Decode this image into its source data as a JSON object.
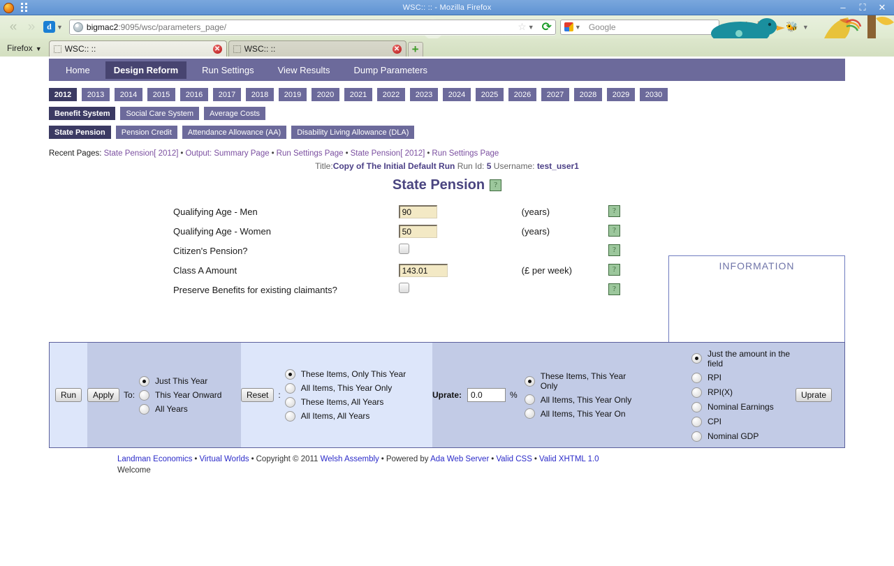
{
  "window": {
    "title": "WSC::  :: - Mozilla Firefox",
    "minimize": "–",
    "maximize": "⛶",
    "close": "✕"
  },
  "browser": {
    "back_icon": "«",
    "forward_icon": "»",
    "d_button": "d",
    "url_host": "bigmac2",
    "url_rest": ":9095/wsc/parameters_page/",
    "url_full": "bigmac2:9095/wsc/parameters_page/",
    "star_icon": "☆",
    "reload_icon": "⟳",
    "search_placeholder": "Google",
    "firefox_menu": "Firefox",
    "toolbar_icons": [
      "binoculars-icon",
      "home-icon",
      "bookmarks-icon",
      "bug-icon"
    ],
    "tabs": [
      {
        "title": "WSC::  ::",
        "active": true
      },
      {
        "title": "WSC::  ::",
        "active": false
      }
    ],
    "new_tab": "+"
  },
  "mainnav": [
    {
      "label": "Home",
      "selected": false
    },
    {
      "label": "Design Reform",
      "selected": true
    },
    {
      "label": "Run Settings",
      "selected": false
    },
    {
      "label": "View Results",
      "selected": false
    },
    {
      "label": "Dump Parameters",
      "selected": false
    }
  ],
  "years": [
    {
      "label": "2012",
      "selected": true
    },
    {
      "label": "2013",
      "selected": false
    },
    {
      "label": "2014",
      "selected": false
    },
    {
      "label": "2015",
      "selected": false
    },
    {
      "label": "2016",
      "selected": false
    },
    {
      "label": "2017",
      "selected": false
    },
    {
      "label": "2018",
      "selected": false
    },
    {
      "label": "2019",
      "selected": false
    },
    {
      "label": "2020",
      "selected": false
    },
    {
      "label": "2021",
      "selected": false
    },
    {
      "label": "2022",
      "selected": false
    },
    {
      "label": "2023",
      "selected": false
    },
    {
      "label": "2024",
      "selected": false
    },
    {
      "label": "2025",
      "selected": false
    },
    {
      "label": "2026",
      "selected": false
    },
    {
      "label": "2027",
      "selected": false
    },
    {
      "label": "2028",
      "selected": false
    },
    {
      "label": "2029",
      "selected": false
    },
    {
      "label": "2030",
      "selected": false
    }
  ],
  "systems": [
    {
      "label": "Benefit System",
      "selected": true
    },
    {
      "label": "Social Care System",
      "selected": false
    },
    {
      "label": "Average Costs",
      "selected": false
    }
  ],
  "benefits": [
    {
      "label": "State Pension",
      "selected": true
    },
    {
      "label": "Pension Credit",
      "selected": false
    },
    {
      "label": "Attendance Allowance (AA)",
      "selected": false
    },
    {
      "label": "Disability Living Allowance (DLA)",
      "selected": false
    }
  ],
  "recent": {
    "label": "Recent Pages:",
    "links": [
      "State Pension[ 2012]",
      "Output: Summary Page",
      "Run Settings Page",
      "State Pension[ 2012]",
      "Run Settings Page"
    ],
    "separator": "•"
  },
  "runinfo": {
    "title_key": "Title:",
    "title_value": "Copy of The Initial Default Run",
    "runid_key": "Run Id:",
    "runid_value": "5",
    "username_key": "Username:",
    "username_value": "test_user1"
  },
  "page": {
    "heading": "State Pension",
    "help_icon": "?"
  },
  "form": {
    "rows": [
      {
        "label": "Qualifying Age - Men",
        "type": "text",
        "value": "90",
        "unit": "(years)",
        "help": "?"
      },
      {
        "label": "Qualifying Age - Women",
        "type": "text",
        "value": "50",
        "unit": "(years)",
        "help": "?"
      },
      {
        "label": "Citizen's Pension?",
        "type": "checkbox",
        "value": "",
        "unit": "",
        "help": "?"
      },
      {
        "label": "Class A Amount",
        "type": "text",
        "value": "143.01",
        "unit": "(£ per week)",
        "help": "?"
      },
      {
        "label": "Preserve Benefits for existing claimants?",
        "type": "checkbox",
        "value": "",
        "unit": "",
        "help": "?"
      }
    ]
  },
  "information": {
    "heading": "INFORMATION",
    "body": ""
  },
  "controls": {
    "run_label": "Run",
    "apply_label": "Apply",
    "apply_to_label": "To:",
    "apply_options": [
      {
        "label": "Just This Year",
        "selected": true
      },
      {
        "label": "This Year Onward",
        "selected": false
      },
      {
        "label": "All Years",
        "selected": false
      }
    ],
    "reset_label": "Reset",
    "reset_colon": ":",
    "reset_options": [
      {
        "label": "These Items, Only This Year",
        "selected": true
      },
      {
        "label": "All Items, This Year Only",
        "selected": false
      },
      {
        "label": "These Items, All Years",
        "selected": false
      },
      {
        "label": "All Items, All Years",
        "selected": false
      }
    ],
    "uprate_label": "Uprate:",
    "uprate_value": "0.0",
    "uprate_percent": "%",
    "uprate_scope_options": [
      {
        "label": "These Items, This Year Only",
        "selected": true
      },
      {
        "label": "All Items, This Year Only",
        "selected": false
      },
      {
        "label": "All Items, This Year On",
        "selected": false
      }
    ],
    "uprate_index_options": [
      {
        "label": "Just the amount in the field",
        "selected": true
      },
      {
        "label": "RPI",
        "selected": false
      },
      {
        "label": "RPI(X)",
        "selected": false
      },
      {
        "label": "Nominal Earnings",
        "selected": false
      },
      {
        "label": "CPI",
        "selected": false
      },
      {
        "label": "Nominal GDP",
        "selected": false
      }
    ],
    "uprate_button": "Uprate"
  },
  "footer": {
    "parts": [
      {
        "text": "Landman Economics",
        "link": true
      },
      {
        "text": "Virtual Worlds",
        "link": true
      },
      {
        "text": "Copyright © 2011",
        "link": false
      },
      {
        "text": "Welsh Assembly",
        "link": true
      },
      {
        "text": "Powered by",
        "link": false
      },
      {
        "text": "Ada Web Server",
        "link": true
      },
      {
        "text": "Valid CSS",
        "link": true
      },
      {
        "text": "Valid XHTML 1.0",
        "link": true
      }
    ],
    "separator": "•",
    "welcome": "Welcome"
  },
  "colors": {
    "nav_purple": "#6c6a9b",
    "nav_purple_dark": "#3b3a63",
    "panel_light": "#dde6fa",
    "panel_dark": "#c2cbe6",
    "field_cream": "#f3e9c5",
    "link_purple": "#7b4fa0",
    "footer_link": "#2b2bc9",
    "title_blue": "#5f93d3"
  }
}
